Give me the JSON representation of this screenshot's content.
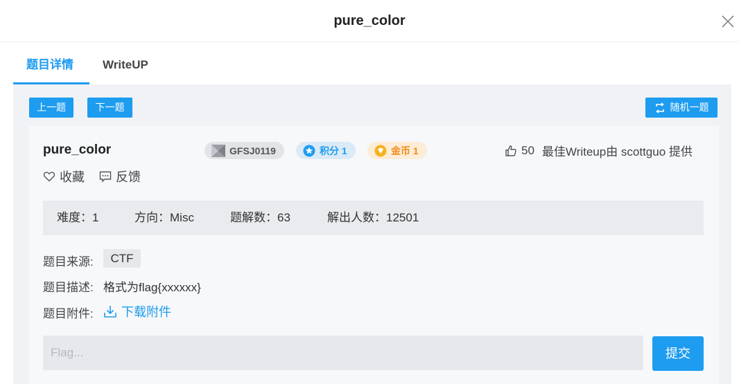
{
  "dialog": {
    "title": "pure_color"
  },
  "tabs": [
    {
      "label": "题目详情",
      "active": true
    },
    {
      "label": "WriteUP",
      "active": false
    }
  ],
  "nav": {
    "prev_label": "上一题",
    "next_label": "下一题",
    "random_label": "随机一题"
  },
  "challenge": {
    "name": "pure_color",
    "id_tag": "GFSJ0119",
    "points_label": "积分 1",
    "coins_label": "金币 1",
    "likes": "50",
    "best_writeup": "最佳Writeup由 scottguo 提供",
    "favorite_label": "收藏",
    "feedback_label": "反馈"
  },
  "stats": {
    "difficulty": "难度：1",
    "direction": "方向：Misc",
    "solves": "题解数：63",
    "solvers": "解出人数：12501"
  },
  "info": {
    "source_label": "题目来源:",
    "source_value": "CTF",
    "desc_label": "题目描述:",
    "desc_value": "格式为flag{xxxxxx}",
    "attach_label": "题目附件:",
    "attach_link": "下载附件"
  },
  "flag": {
    "placeholder": "Flag...",
    "value": "",
    "submit_label": "提交"
  },
  "colors": {
    "accent": "#1e9cf0",
    "points_bg": "#dbeaf7",
    "coins_bg": "#fdecd6",
    "coins_text": "#f08c1a"
  }
}
